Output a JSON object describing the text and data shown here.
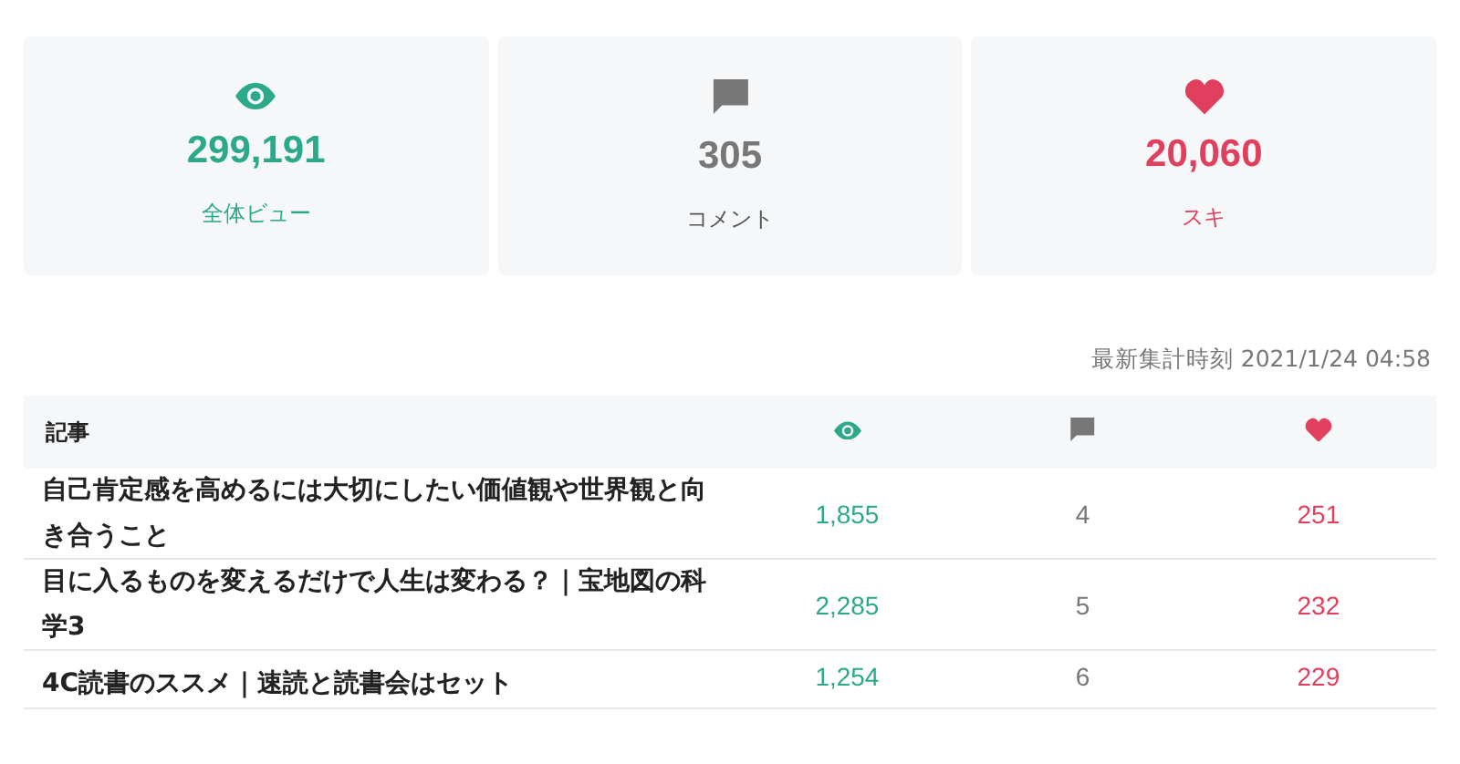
{
  "stats": [
    {
      "kind": "views",
      "value": "299,191",
      "label": "全体ビュー"
    },
    {
      "kind": "comments",
      "value": "305",
      "label": "コメント"
    },
    {
      "kind": "likes",
      "value": "20,060",
      "label": "スキ"
    }
  ],
  "updated": "最新集計時刻 2021/1/24 04:58",
  "table": {
    "columns": [
      {
        "kind": "text",
        "label": "記事"
      },
      {
        "kind": "views"
      },
      {
        "kind": "comments"
      },
      {
        "kind": "likes"
      }
    ],
    "rows": [
      {
        "title": "自己肯定感を高めるには大切にしたい価値観や世界観と向き合うこと",
        "views": "1,855",
        "comments": "4",
        "likes": "251"
      },
      {
        "title": "目に入るものを変えるだけで人生は変わる？｜宝地図の科学3",
        "views": "2,285",
        "comments": "5",
        "likes": "232"
      },
      {
        "title": "4C読書のススメ｜速読と読書会はセット",
        "views": "1,254",
        "comments": "6",
        "likes": "229"
      }
    ]
  }
}
